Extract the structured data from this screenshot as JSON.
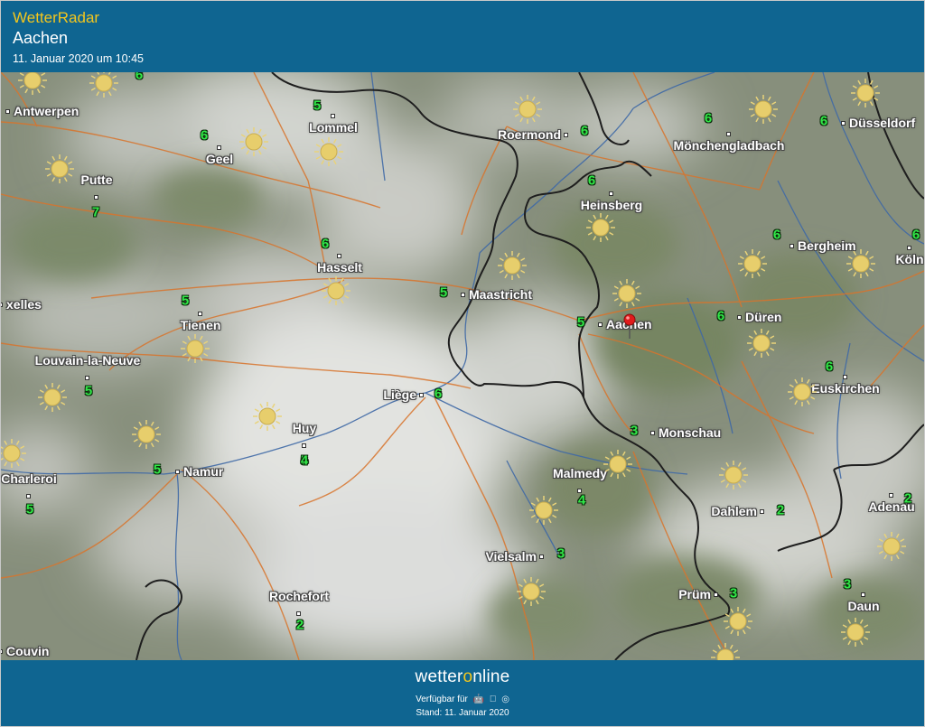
{
  "header": {
    "app_title": "WetterRadar",
    "location": "Aachen",
    "timestamp": "11. Januar 2020 um 10:45"
  },
  "map": {
    "colors": {
      "roads": "#d8742c",
      "borders": "#1e1e1e",
      "rivers": "#3f69a6",
      "temperature": "#31e848",
      "header": "#0f6591",
      "brand_accent": "#f3c61d"
    },
    "weather_icon": "sun-icon",
    "marker": {
      "icon": "location-pin-icon",
      "place": "Aachen"
    },
    "cities": [
      "Antwerpen",
      "Lommel",
      "Roermond",
      "Mönchengladbach",
      "Düsseldorf",
      "Geel",
      "Putte",
      "Heinsberg",
      "Hasselt",
      "Bergheim",
      "Köln",
      "xelles",
      "Maastricht",
      "Tienen",
      "Aachen",
      "Düren",
      "Louvain-la-Neuve",
      "Liège",
      "Euskirchen",
      "Huy",
      "Monschau",
      "Namur",
      "Charleroi",
      "Malmedy",
      "Dahlem",
      "Adenau",
      "Vielsalm",
      "Prüm",
      "Rochefort",
      "Daun",
      "Couvin"
    ],
    "temperatures": [
      "6",
      "5",
      "6",
      "6",
      "6",
      "6",
      "7",
      "6",
      "6",
      "6",
      "6",
      "5",
      "5",
      "5",
      "6",
      "6",
      "5",
      "6",
      "5",
      "5",
      "3",
      "5",
      "4",
      "3",
      "2",
      "2",
      "3",
      "3",
      "2",
      "4"
    ]
  },
  "footer": {
    "brand_part1": "wetter",
    "brand_part2": "o",
    "brand_part3": "nline",
    "availability": "Verfügbar für",
    "platform_icons": [
      "android-icon",
      "apple-icon",
      "web-icon"
    ],
    "stand": "Stand: 11. Januar 2020"
  }
}
